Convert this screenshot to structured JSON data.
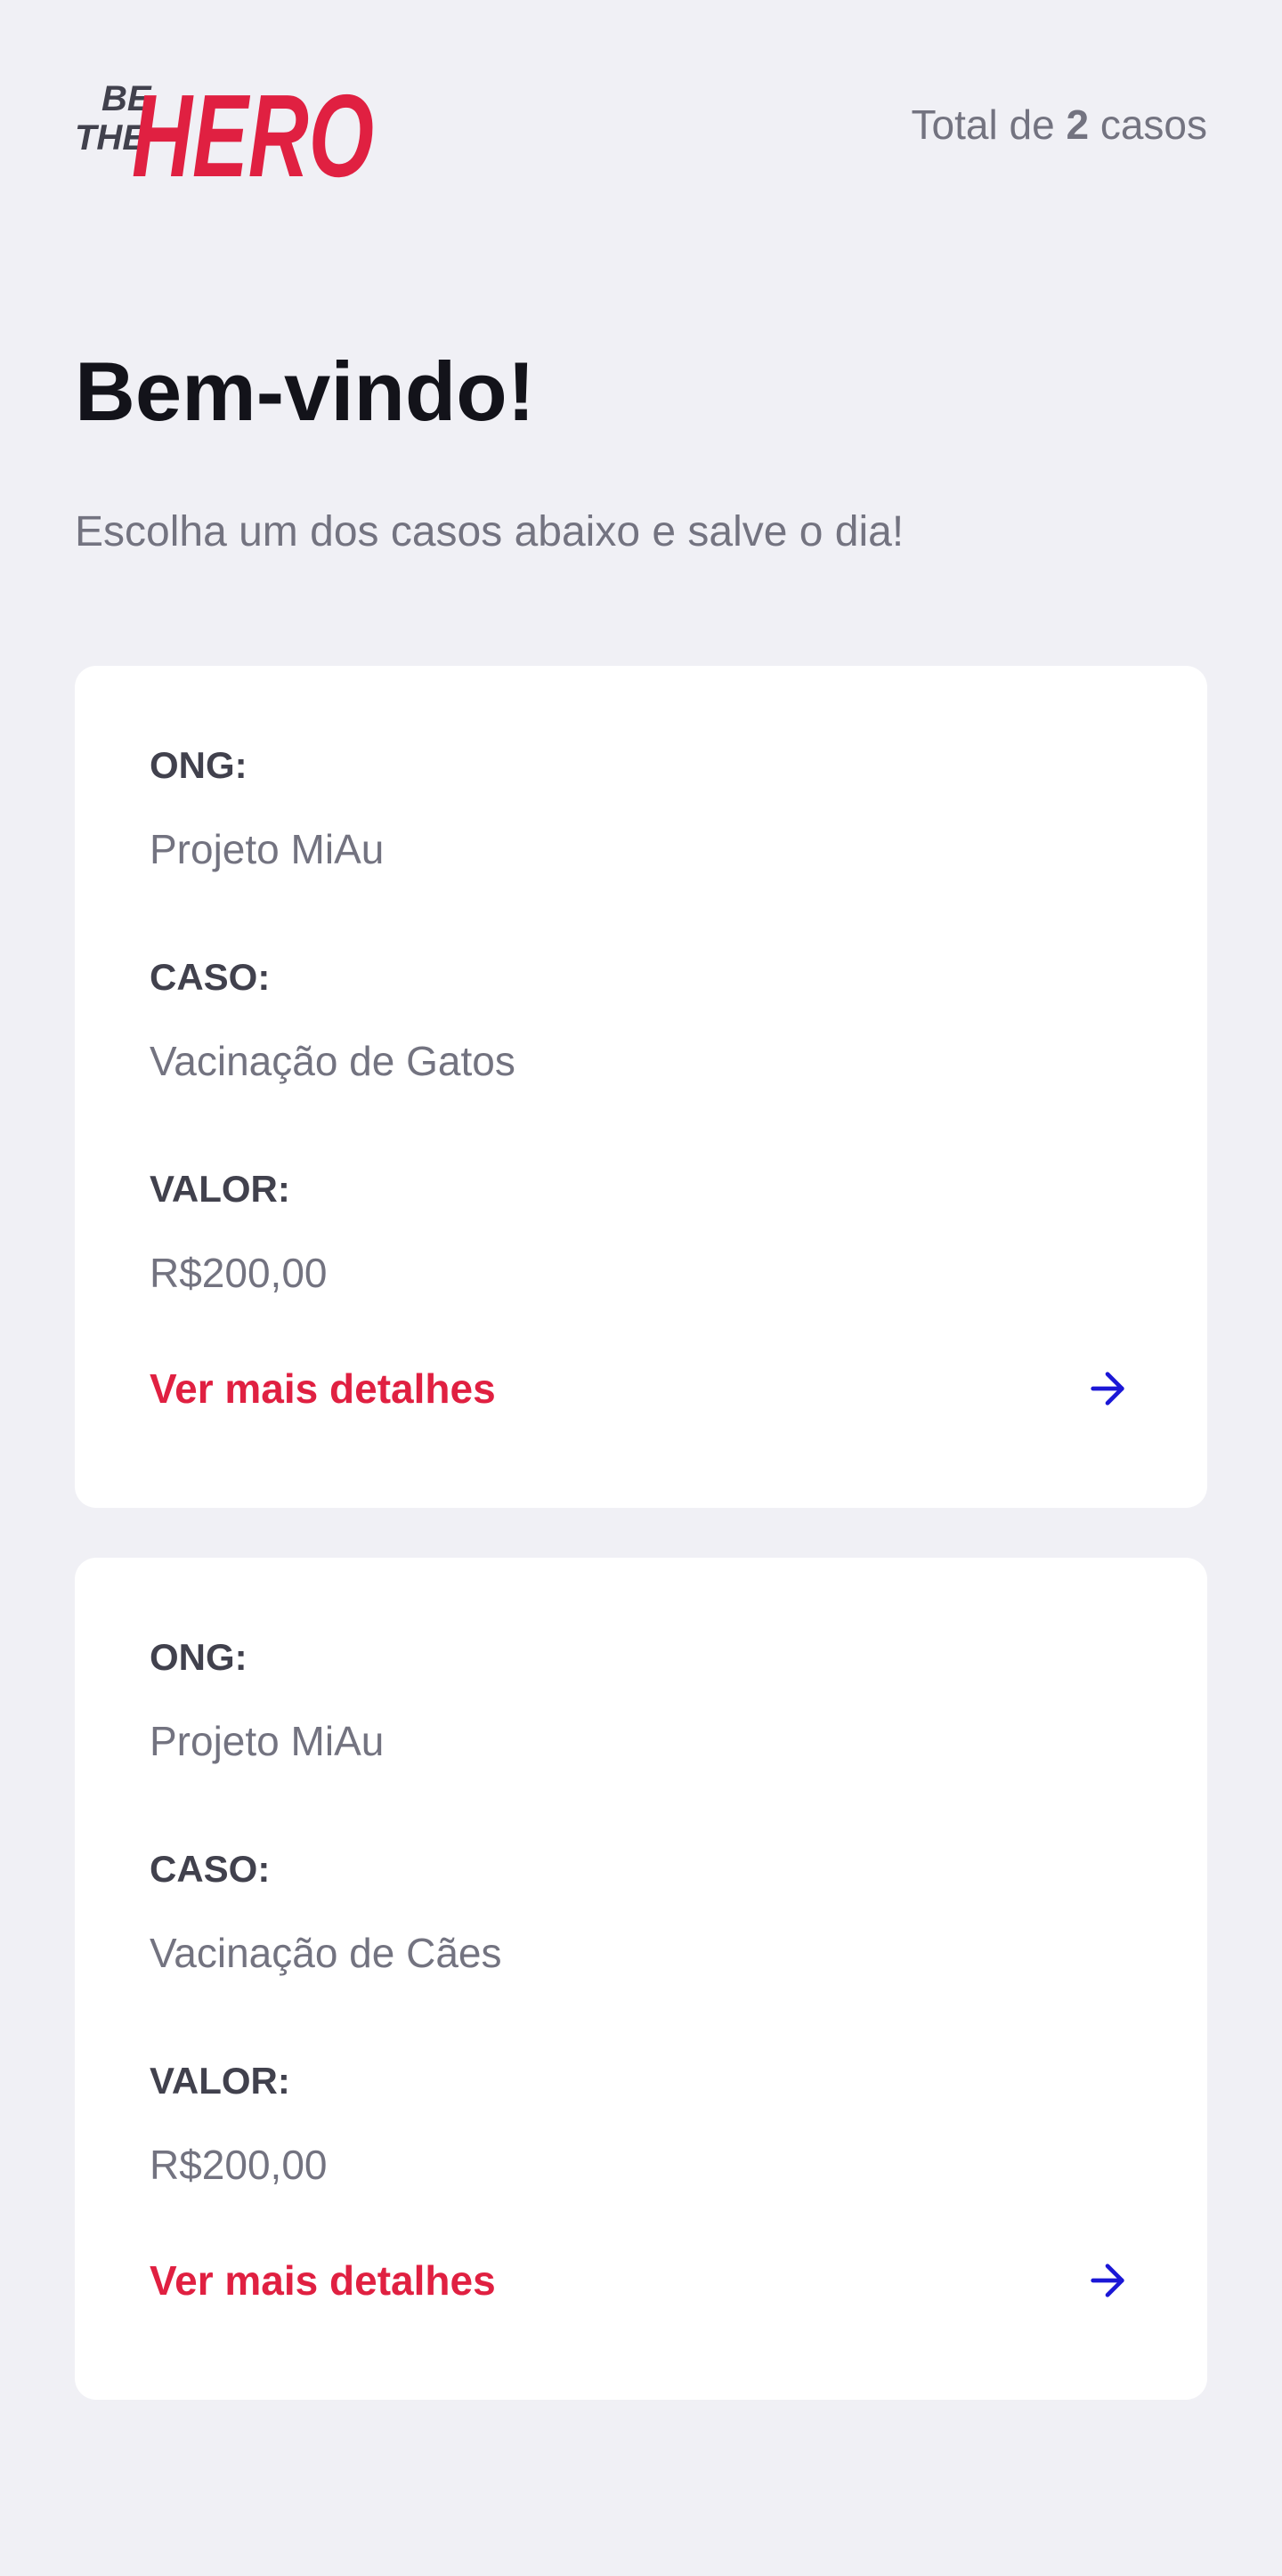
{
  "header": {
    "logo_text_small_1": "BE",
    "logo_text_small_2": "THE",
    "logo_text_big": "HERO",
    "total_prefix": "Total de ",
    "total_count": "2",
    "total_suffix": " casos"
  },
  "main": {
    "title": "Bem-vindo!",
    "subtitle": "Escolha um dos casos abaixo e salve o dia!"
  },
  "cases": [
    {
      "ong_label": "ONG:",
      "ong_value": "Projeto MiAu",
      "case_label": "CASO:",
      "case_value": "Vacinação de Gatos",
      "value_label": "VALOR:",
      "value_value": "R$200,00",
      "details_label": "Ver mais detalhes"
    },
    {
      "ong_label": "ONG:",
      "ong_value": "Projeto MiAu",
      "case_label": "CASO:",
      "case_value": "Vacinação de Cães",
      "value_label": "VALOR:",
      "value_value": "R$200,00",
      "details_label": "Ver mais detalhes"
    }
  ],
  "icons": {
    "details_arrow": "arrow-right-icon"
  },
  "colors": {
    "background": "#f0f0f5",
    "brand_red": "#e02041",
    "arrow_blue": "#1b17d6",
    "heading": "#13131a",
    "muted_text": "#737380",
    "label_text": "#41414d",
    "card": "#ffffff"
  }
}
